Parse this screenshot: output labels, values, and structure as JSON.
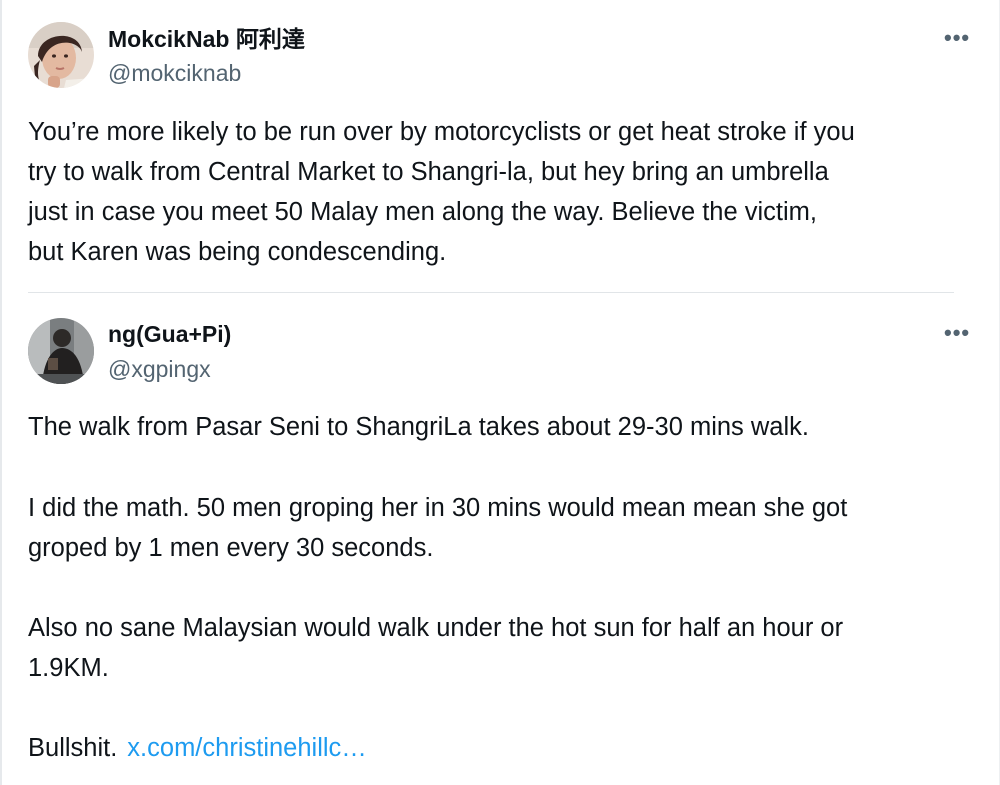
{
  "tweet1": {
    "name": "MokcikNab 阿利達",
    "handle": "@mokciknab",
    "more_icon": "more-horizontal-icon",
    "lines": [
      "You’re more likely to be run over by motorcyclists or get heat stroke if you",
      "try to walk from Central Market to Shangri-la, but hey bring an umbrella",
      "just in case you meet 50 Malay men along the way. Believe the victim,",
      "but Karen was being condescending."
    ]
  },
  "tweet2": {
    "name": "ng(Gua+Pi)",
    "handle": "@xgpingx",
    "more_icon": "more-horizontal-icon",
    "paragraph1": "The walk from Pasar Seni to ShangriLa takes about 29-30 mins walk.",
    "paragraph2_lines": [
      "I did the math. 50 men groping her in 30 mins would mean mean she got",
      "groped by 1 men every 30 seconds."
    ],
    "paragraph3_lines": [
      "Also no sane Malaysian would walk under the hot sun for half an hour or",
      "1.9KM."
    ],
    "closing_text": "Bullshit.",
    "link_text": "x.com/christinehillc…"
  },
  "colors": {
    "text": "#0f1419",
    "secondary": "#536471",
    "link": "#1d9bf0",
    "divider": "#e1e5e8"
  }
}
